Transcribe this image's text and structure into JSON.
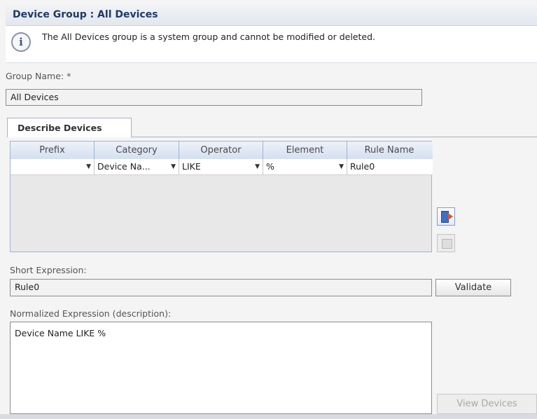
{
  "header": {
    "title": "Device Group : All Devices"
  },
  "info": {
    "icon": "info-icon",
    "message": "The All Devices group is a system group and cannot be modified or deleted."
  },
  "group_name": {
    "label": "Group Name: *",
    "value": "All Devices"
  },
  "tabs": [
    {
      "label": "Describe Devices",
      "active": true
    }
  ],
  "rules_grid": {
    "columns": [
      "Prefix",
      "Category",
      "Operator",
      "Element",
      "Rule Name"
    ],
    "rows": [
      {
        "prefix": "",
        "category": "Device Na...",
        "operator": "LIKE",
        "element": "%",
        "rule_name": "Rule0"
      }
    ]
  },
  "side_buttons": [
    {
      "name": "add-rule-button",
      "icon": "add-row-icon",
      "enabled": true
    },
    {
      "name": "remove-rule-button",
      "icon": "remove-row-icon",
      "enabled": false
    }
  ],
  "short_expression": {
    "label": "Short Expression:",
    "value": "Rule0",
    "button": "Validate"
  },
  "normalized_expression": {
    "label": "Normalized Expression (description):",
    "value": "Device Name LIKE %"
  },
  "view_devices": {
    "label": "View Devices",
    "enabled": false
  },
  "colors": {
    "title": "#1e3a66",
    "grid_border": "#9fb3d3",
    "add_icon": "#3d6fc4",
    "add_arrow": "#e0542a"
  }
}
